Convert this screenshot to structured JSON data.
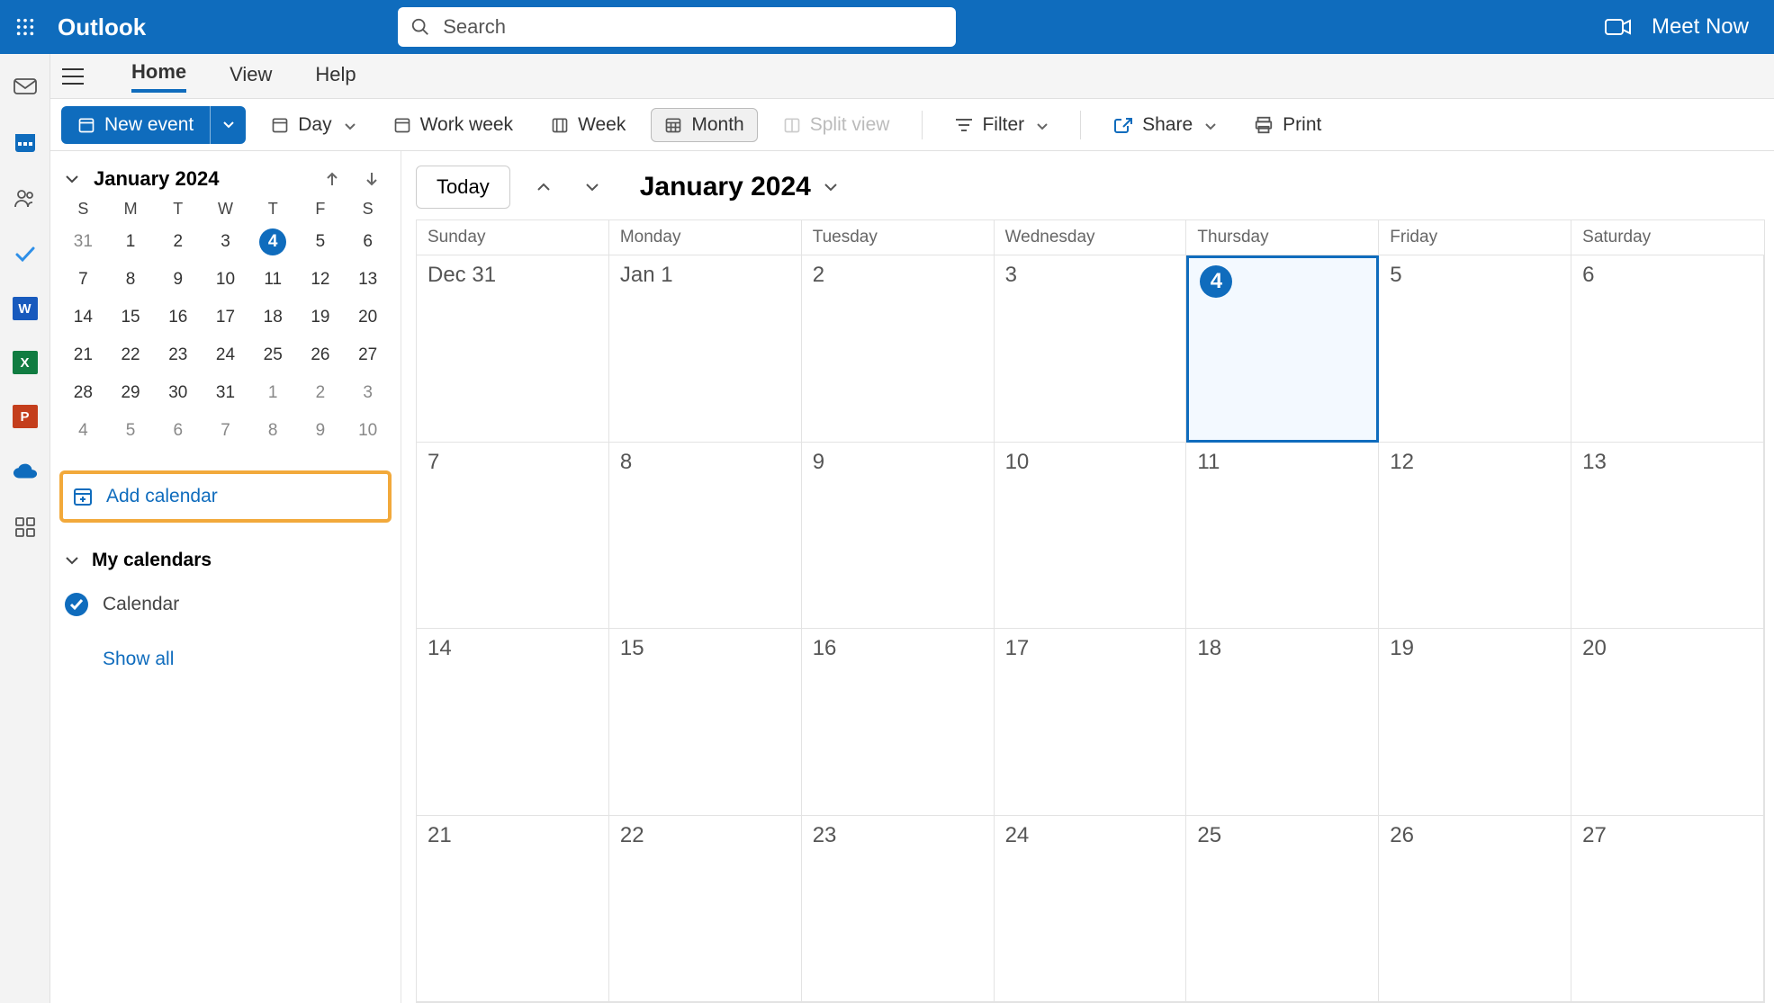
{
  "topbar": {
    "title": "Outlook",
    "search_placeholder": "Search",
    "meet_now": "Meet Now"
  },
  "ribbon_tabs": {
    "home": "Home",
    "view": "View",
    "help": "Help"
  },
  "toolbar": {
    "new_event": "New event",
    "day": "Day",
    "work_week": "Work week",
    "week": "Week",
    "month": "Month",
    "split_view": "Split view",
    "filter": "Filter",
    "share": "Share",
    "print": "Print"
  },
  "sidebar": {
    "mini_month_label": "January 2024",
    "day_headers": [
      "S",
      "M",
      "T",
      "W",
      "T",
      "F",
      "S"
    ],
    "mini_rows": [
      [
        {
          "n": "31",
          "dim": true
        },
        {
          "n": "1"
        },
        {
          "n": "2"
        },
        {
          "n": "3"
        },
        {
          "n": "4",
          "today": true
        },
        {
          "n": "5"
        },
        {
          "n": "6"
        }
      ],
      [
        {
          "n": "7"
        },
        {
          "n": "8"
        },
        {
          "n": "9"
        },
        {
          "n": "10"
        },
        {
          "n": "11"
        },
        {
          "n": "12"
        },
        {
          "n": "13"
        }
      ],
      [
        {
          "n": "14"
        },
        {
          "n": "15"
        },
        {
          "n": "16"
        },
        {
          "n": "17"
        },
        {
          "n": "18"
        },
        {
          "n": "19"
        },
        {
          "n": "20"
        }
      ],
      [
        {
          "n": "21"
        },
        {
          "n": "22"
        },
        {
          "n": "23"
        },
        {
          "n": "24"
        },
        {
          "n": "25"
        },
        {
          "n": "26"
        },
        {
          "n": "27"
        }
      ],
      [
        {
          "n": "28"
        },
        {
          "n": "29"
        },
        {
          "n": "30"
        },
        {
          "n": "31"
        },
        {
          "n": "1",
          "dim": true
        },
        {
          "n": "2",
          "dim": true
        },
        {
          "n": "3",
          "dim": true
        }
      ],
      [
        {
          "n": "4",
          "dim": true
        },
        {
          "n": "5",
          "dim": true
        },
        {
          "n": "6",
          "dim": true
        },
        {
          "n": "7",
          "dim": true
        },
        {
          "n": "8",
          "dim": true
        },
        {
          "n": "9",
          "dim": true
        },
        {
          "n": "10",
          "dim": true
        }
      ]
    ],
    "add_calendar": "Add calendar",
    "my_calendars": "My calendars",
    "calendar_item": "Calendar",
    "show_all": "Show all"
  },
  "calmain": {
    "today_btn": "Today",
    "range_label": "January 2024",
    "day_headers": [
      "Sunday",
      "Monday",
      "Tuesday",
      "Wednesday",
      "Thursday",
      "Friday",
      "Saturday"
    ],
    "weeks": [
      [
        {
          "label": "Dec 31"
        },
        {
          "label": "Jan 1"
        },
        {
          "label": "2"
        },
        {
          "label": "3"
        },
        {
          "label": "4",
          "today": true
        },
        {
          "label": "5"
        },
        {
          "label": "6"
        }
      ],
      [
        {
          "label": "7"
        },
        {
          "label": "8"
        },
        {
          "label": "9"
        },
        {
          "label": "10"
        },
        {
          "label": "11"
        },
        {
          "label": "12"
        },
        {
          "label": "13"
        }
      ],
      [
        {
          "label": "14"
        },
        {
          "label": "15"
        },
        {
          "label": "16"
        },
        {
          "label": "17"
        },
        {
          "label": "18"
        },
        {
          "label": "19"
        },
        {
          "label": "20"
        }
      ],
      [
        {
          "label": "21"
        },
        {
          "label": "22"
        },
        {
          "label": "23"
        },
        {
          "label": "24"
        },
        {
          "label": "25"
        },
        {
          "label": "26"
        },
        {
          "label": "27"
        }
      ]
    ]
  }
}
